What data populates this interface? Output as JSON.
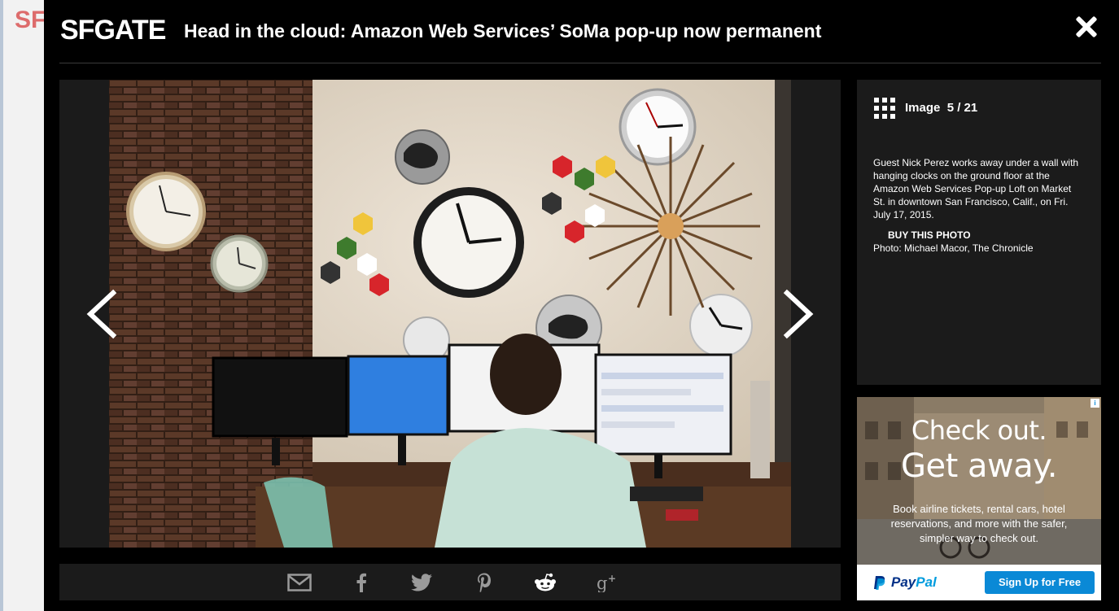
{
  "background_page": {
    "logo": "SF"
  },
  "header": {
    "brand": "SFGATE",
    "title": "Head in the cloud: Amazon Web Services’ SoMa pop-up now permanent"
  },
  "gallery": {
    "image_label": "Image",
    "counter": "5 / 21",
    "caption": "Guest Nick Perez works away under a wall with hanging clocks on the ground floor at the Amazon Web Services Pop-up Loft on Market St. in downtown San Francisco, Calif., on Fri. July 17, 2015.",
    "buy_label": "BUY THIS PHOTO",
    "credit": "Photo: Michael Macor, The Chronicle"
  },
  "share": [
    "email-icon",
    "facebook-icon",
    "twitter-icon",
    "pinterest-icon",
    "reddit-icon",
    "google-plus-icon"
  ],
  "ad": {
    "headline_1": "Check out.",
    "headline_2": "Get away.",
    "body": "Book airline tickets, rental cars, hotel reservations, and more with the safer, simpler way to check out.",
    "brand_a": "Pay",
    "brand_b": "Pal",
    "cta": "Sign Up for Free"
  },
  "colors": {
    "modal_bg": "#000000",
    "panel_bg": "#1b1b1b",
    "paypal_navy": "#003087",
    "paypal_blue": "#009cde",
    "cta_blue": "#0a89d6"
  }
}
